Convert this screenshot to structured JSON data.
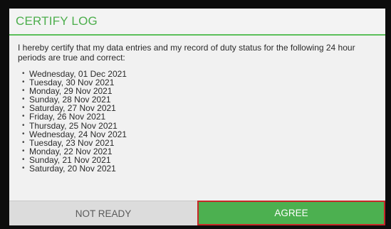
{
  "dialog": {
    "title": "CERTIFY LOG",
    "statement": "I hereby certify that my data entries and my record of duty status for the following 24 hour periods are true and correct:",
    "dates": [
      "Wednesday, 01 Dec 2021",
      "Tuesday, 30 Nov 2021",
      "Monday, 29 Nov 2021",
      "Sunday, 28 Nov 2021",
      "Saturday, 27 Nov 2021",
      "Friday, 26 Nov 2021",
      "Thursday, 25 Nov 2021",
      "Wednesday, 24 Nov 2021",
      "Tuesday, 23 Nov 2021",
      "Monday, 22 Nov 2021",
      "Sunday, 21 Nov 2021",
      "Saturday, 20 Nov 2021"
    ],
    "bullet": "•"
  },
  "buttons": {
    "not_ready_label": "NOT READY",
    "agree_label": "AGREE"
  },
  "colors": {
    "accent_green": "#4cae4c",
    "agree_bg": "#4cb050",
    "agree_border": "#c62828",
    "not_ready_bg": "#dcdcdc",
    "dialog_bg": "#f1f1f1",
    "backdrop": "#0d0d0d"
  }
}
